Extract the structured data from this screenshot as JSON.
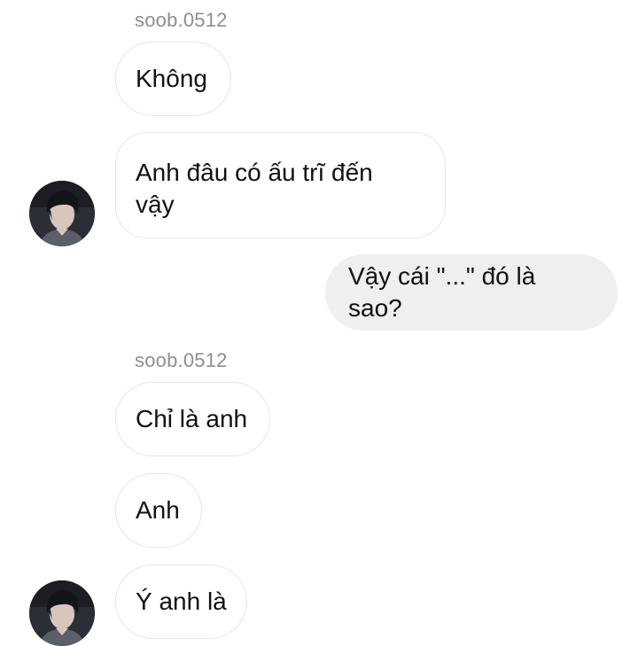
{
  "thread": {
    "messages": [
      {
        "sender": "soob.0512",
        "text": "Không",
        "direction": "incoming"
      },
      {
        "text": "Anh đâu có ấu trĩ đến vậy",
        "text_line1": "Anh đâu có ấu trĩ đến",
        "text_line2": "vậy",
        "direction": "incoming"
      },
      {
        "text": "Vậy cái \"...\" đó là sao?",
        "direction": "outgoing"
      },
      {
        "sender": "soob.0512",
        "text": "Chỉ là anh",
        "direction": "incoming"
      },
      {
        "text": "Anh",
        "direction": "incoming"
      },
      {
        "text": "Ý anh là",
        "direction": "incoming"
      }
    ]
  },
  "colors": {
    "incoming_bubble": "#ffffff",
    "incoming_border": "#e6e6e6",
    "outgoing_bubble": "#efefef",
    "sender_name": "#8e8e8e",
    "text": "#111111"
  },
  "icons": {
    "avatar": "profile-photo-avatar"
  }
}
